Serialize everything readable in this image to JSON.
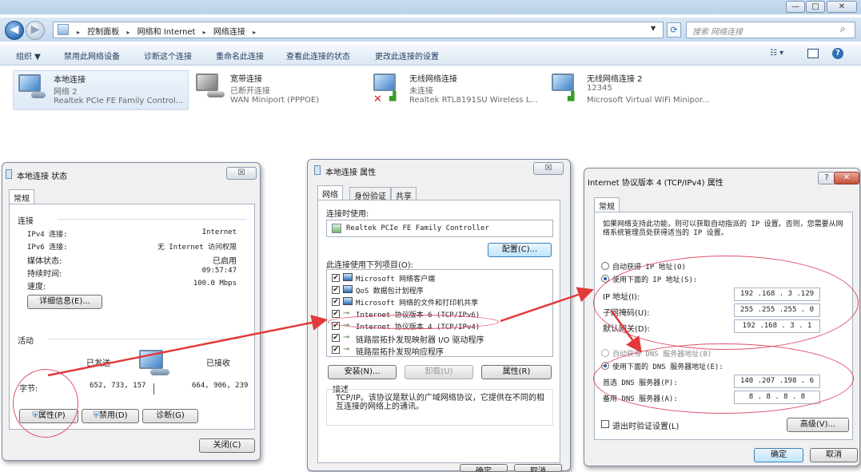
{
  "explorer": {
    "window_buttons": [
      "—",
      "□",
      "✕"
    ],
    "breadcrumbs": [
      "控制面板",
      "网络和 Internet",
      "网络连接"
    ],
    "search_placeholder": "搜索 网络连接",
    "toolbar": [
      "组织 ▼",
      "禁用此网络设备",
      "诊断这个连接",
      "重命名此连接",
      "查看此连接的状态",
      "更改此连接的设置"
    ],
    "connections": [
      {
        "name": "本地连接",
        "status": "网络 2",
        "device": "Realtek PCIe FE Family Control...",
        "icon": "ethernet-icon"
      },
      {
        "name": "宽带连接",
        "status": "已断开连接",
        "device": "WAN Miniport (PPPOE)",
        "icon": "broadband-icon"
      },
      {
        "name": "无线网络连接",
        "status": "未连接",
        "device": "Realtek RTL8191SU Wireless L...",
        "icon": "wireless-disconnected-icon"
      },
      {
        "name": "无线网络连接 2",
        "status": "12345",
        "device": "Microsoft Virtual WiFi Minipor...",
        "icon": "wireless-icon"
      }
    ]
  },
  "status_dialog": {
    "title": "本地连接 状态",
    "close": "☒",
    "tab": "常规",
    "section_connection": "连接",
    "rows": [
      {
        "label": "IPv4 连接:",
        "value": "Internet"
      },
      {
        "label": "IPv6 连接:",
        "value": "无 Internet 访问权限"
      },
      {
        "label": "媒体状态:",
        "value": "已启用"
      },
      {
        "label": "持续时间:",
        "value": "09:57:47"
      },
      {
        "label": "速度:",
        "value": "100.0 Mbps"
      }
    ],
    "details_button": "详细信息(E)...",
    "section_activity": "活动",
    "sent_label": "已发送",
    "received_label": "已接收",
    "bytes_label": "字节:",
    "bytes_sent": "652, 733, 157",
    "bytes_received": "664, 906, 239",
    "properties_button": "属性(P)",
    "disable_button": "禁用(D)",
    "diagnose_button": "诊断(G)",
    "close_button": "关闭(C)"
  },
  "properties_dialog": {
    "title": "本地连接 属性",
    "close": "☒",
    "tabs": [
      "网络",
      "身份验证",
      "共享"
    ],
    "connect_using_label": "连接时使用:",
    "adapter": "Realtek PCIe FE Family Controller",
    "configure_button": "配置(C)...",
    "items_label": "此连接使用下列项目(O):",
    "items": [
      "Microsoft 网络客户端",
      "QoS 数据包计划程序",
      "Microsoft 网络的文件和打印机共享",
      "Internet 协议版本 6 (TCP/IPv6)",
      "Internet 协议版本 4 (TCP/IPv4)",
      "链路层拓扑发现映射器 I/O 驱动程序",
      "链路层拓扑发现响应程序"
    ],
    "install_button": "安装(N)...",
    "uninstall_button": "卸载(U)",
    "properties_button": "属性(R)",
    "description_label": "描述",
    "description": "TCP/IP。该协议是默认的广域网络协议，它提供在不同的相互连接的网络上的通讯。",
    "ok_button": "确定",
    "cancel_button": "取消"
  },
  "ipv4_dialog": {
    "title": "Internet 协议版本 4 (TCP/IPv4) 属性",
    "help": "?",
    "close": "✕",
    "tab": "常规",
    "intro": "如果网络支持此功能，则可以获取自动指派的 IP 设置。否则，您需要从网络系统管理员处获得适当的 IP 设置。",
    "auto_ip": "自动获得 IP 地址(O)",
    "manual_ip": "使用下面的 IP 地址(S):",
    "ip_label": "IP 地址(I):",
    "ip_value": "192 .168 . 3 .129",
    "mask_label": "子网掩码(U):",
    "mask_value": "255 .255 .255 . 0",
    "gateway_label": "默认网关(D):",
    "gateway_value": "192 .168 . 3 . 1",
    "auto_dns": "自动获得 DNS 服务器地址(B)",
    "manual_dns": "使用下面的 DNS 服务器地址(E):",
    "dns1_label": "首选 DNS 服务器(P):",
    "dns1_value": "140 .207 .198 . 6",
    "dns2_label": "备用 DNS 服务器(A):",
    "dns2_value": "8 . 8 . 8 . 8",
    "validate_label": "退出时验证设置(L)",
    "advanced_button": "高级(V)...",
    "ok_button": "确定",
    "cancel_button": "取消"
  },
  "colors": {
    "annotation": "#e0506a",
    "arrow": "#e23a3a"
  }
}
